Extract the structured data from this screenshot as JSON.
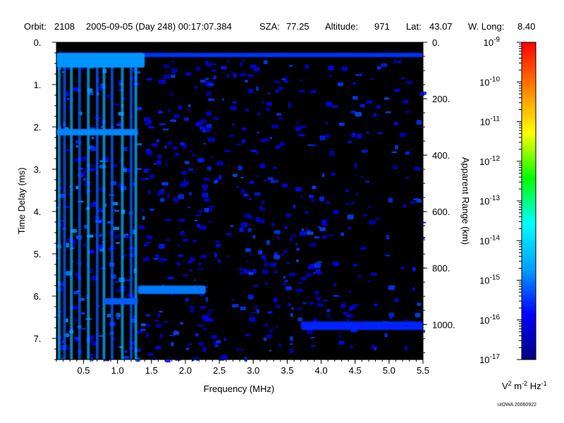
{
  "header": {
    "orbit_label": "Orbit:",
    "orbit_value": "2108",
    "datetime": "2005-09-05 (Day 248) 00:17:07.384",
    "sza_label": "SZA:",
    "sza_value": "77.25",
    "altitude_label": "Altitude:",
    "altitude_value": "971",
    "lat_label": "Lat:",
    "lat_value": "43.07",
    "wlong_label": "W. Long:",
    "wlong_value": "8.40"
  },
  "credit": "uIOWA 20060922",
  "chart_data": {
    "type": "heatmap",
    "title": "",
    "xlabel": "Frequency (MHz)",
    "ylabel": "Time Delay (ms)",
    "y2label": "Apparent Range (km)",
    "xlim": [
      0.1,
      5.5
    ],
    "ylim": [
      0,
      7.5
    ],
    "y_inverted": true,
    "x_ticks": [
      "0.5",
      "1.0",
      "1.5",
      "2.0",
      "2.5",
      "3.0",
      "3.5",
      "4.0",
      "4.5",
      "5.0",
      "5.5"
    ],
    "y_ticks": [
      "0.",
      "1.",
      "2.",
      "3.",
      "4.",
      "5.",
      "6.",
      "7."
    ],
    "y2_ticks": [
      "0.",
      "200.",
      "400.",
      "600.",
      "800.",
      "1000."
    ],
    "y2_tick_values_km": [
      0,
      200,
      400,
      600,
      800,
      1000
    ],
    "km_per_ms": 149.9,
    "colorbar": {
      "label_base": "V",
      "label_exp1": "2",
      "label_mid": " m",
      "label_exp2": "-2",
      "label_mid2": " Hz",
      "label_exp3": "-1",
      "log_range": [
        -17,
        -9
      ],
      "ticks": [
        {
          "base": "10",
          "exp": "-9",
          "value": -9
        },
        {
          "base": "10",
          "exp": "-10",
          "value": -10
        },
        {
          "base": "10",
          "exp": "-11",
          "value": -11
        },
        {
          "base": "10",
          "exp": "-12",
          "value": -12
        },
        {
          "base": "10",
          "exp": "-13",
          "value": -13
        },
        {
          "base": "10",
          "exp": "-14",
          "value": -14
        },
        {
          "base": "10",
          "exp": "-15",
          "value": -15
        },
        {
          "base": "10",
          "exp": "-16",
          "value": -16
        },
        {
          "base": "10",
          "exp": "-17",
          "value": -17
        }
      ],
      "colors": [
        "#000080",
        "#0000ff",
        "#00a0ff",
        "#00ffff",
        "#00ff00",
        "#ffff00",
        "#ff8000",
        "#ff0000"
      ]
    },
    "features": [
      {
        "x": [
          0.1,
          5.5
        ],
        "y": [
          0.25,
          0.35
        ],
        "level": -15.5
      },
      {
        "x": [
          0.1,
          1.4
        ],
        "y": [
          0.25,
          0.6
        ],
        "level": -14.8
      },
      {
        "x": [
          0.1,
          1.3
        ],
        "y": [
          2.05,
          2.2
        ],
        "level": -14.9
      },
      {
        "x": [
          1.3,
          2.3
        ],
        "y": [
          5.75,
          5.95
        ],
        "level": -15.0
      },
      {
        "x": [
          0.8,
          1.3
        ],
        "y": [
          6.05,
          6.2
        ],
        "level": -15.2
      },
      {
        "x": [
          3.7,
          5.5
        ],
        "y": [
          6.6,
          6.8
        ],
        "level": -15.6
      }
    ]
  }
}
